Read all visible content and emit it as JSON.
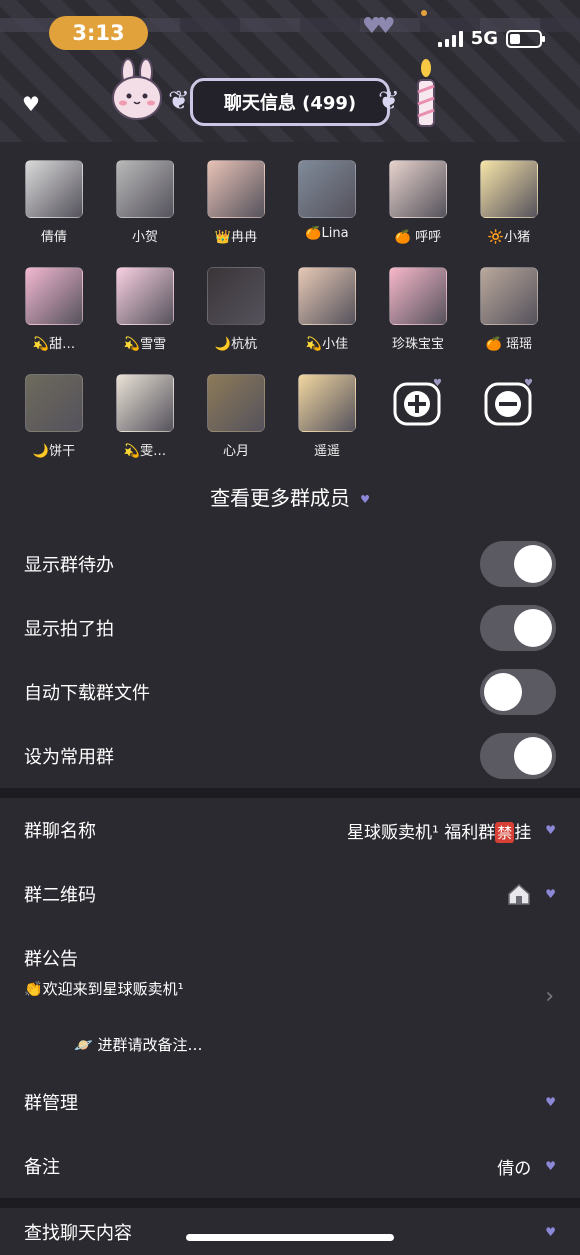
{
  "status": {
    "time": "3:13",
    "network": "5G"
  },
  "header": {
    "title": "聊天信息 (499)"
  },
  "members": [
    {
      "name": "倩倩",
      "color": "#d9d9d9"
    },
    {
      "name": "小贺",
      "color": "#b8b8b8"
    },
    {
      "name": "👑冉冉",
      "color": "#e8c2b6"
    },
    {
      "name": "🍊Lina",
      "color": "#7f8a99"
    },
    {
      "name": "🍊 呼呼",
      "color": "#e6d2cc"
    },
    {
      "name": "🔆小猪",
      "color": "#f6e4a8"
    },
    {
      "name": "💫甜…",
      "color": "#f2b7d1"
    },
    {
      "name": "💫雪雪",
      "color": "#f7cfe0"
    },
    {
      "name": "🌙杭杭",
      "color": "#3a3538"
    },
    {
      "name": "💫小佳",
      "color": "#e6c8b4"
    },
    {
      "name": "珍珠宝宝",
      "color": "#f6b7c9"
    },
    {
      "name": "🍊 瑶瑶",
      "color": "#b9a89c"
    },
    {
      "name": "🌙饼干",
      "color": "#6d6a5c"
    },
    {
      "name": "💫雯…",
      "color": "#e9e2d6"
    },
    {
      "name": "心月",
      "color": "#8c7a58"
    },
    {
      "name": "遥遥",
      "color": "#f1d6a0"
    }
  ],
  "view_more": "查看更多群成员",
  "toggles": [
    {
      "label": "显示群待办",
      "on": true
    },
    {
      "label": "显示拍了拍",
      "on": true
    },
    {
      "label": "自动下载群文件",
      "on": false
    },
    {
      "label": "设为常用群",
      "on": true
    }
  ],
  "group_name": {
    "label": "群聊名称",
    "value_pre": "星球贩卖机¹ 福利群",
    "badge": "禁",
    "value_post": "挂"
  },
  "qr": {
    "label": "群二维码"
  },
  "notice": {
    "label": "群公告",
    "line1": "👏欢迎来到星球贩卖机¹",
    "line2": "🪐 进群请改备注…"
  },
  "manage": {
    "label": "群管理"
  },
  "remark": {
    "label": "备注",
    "value": "倩の"
  },
  "search": {
    "label": "查找聊天内容"
  }
}
